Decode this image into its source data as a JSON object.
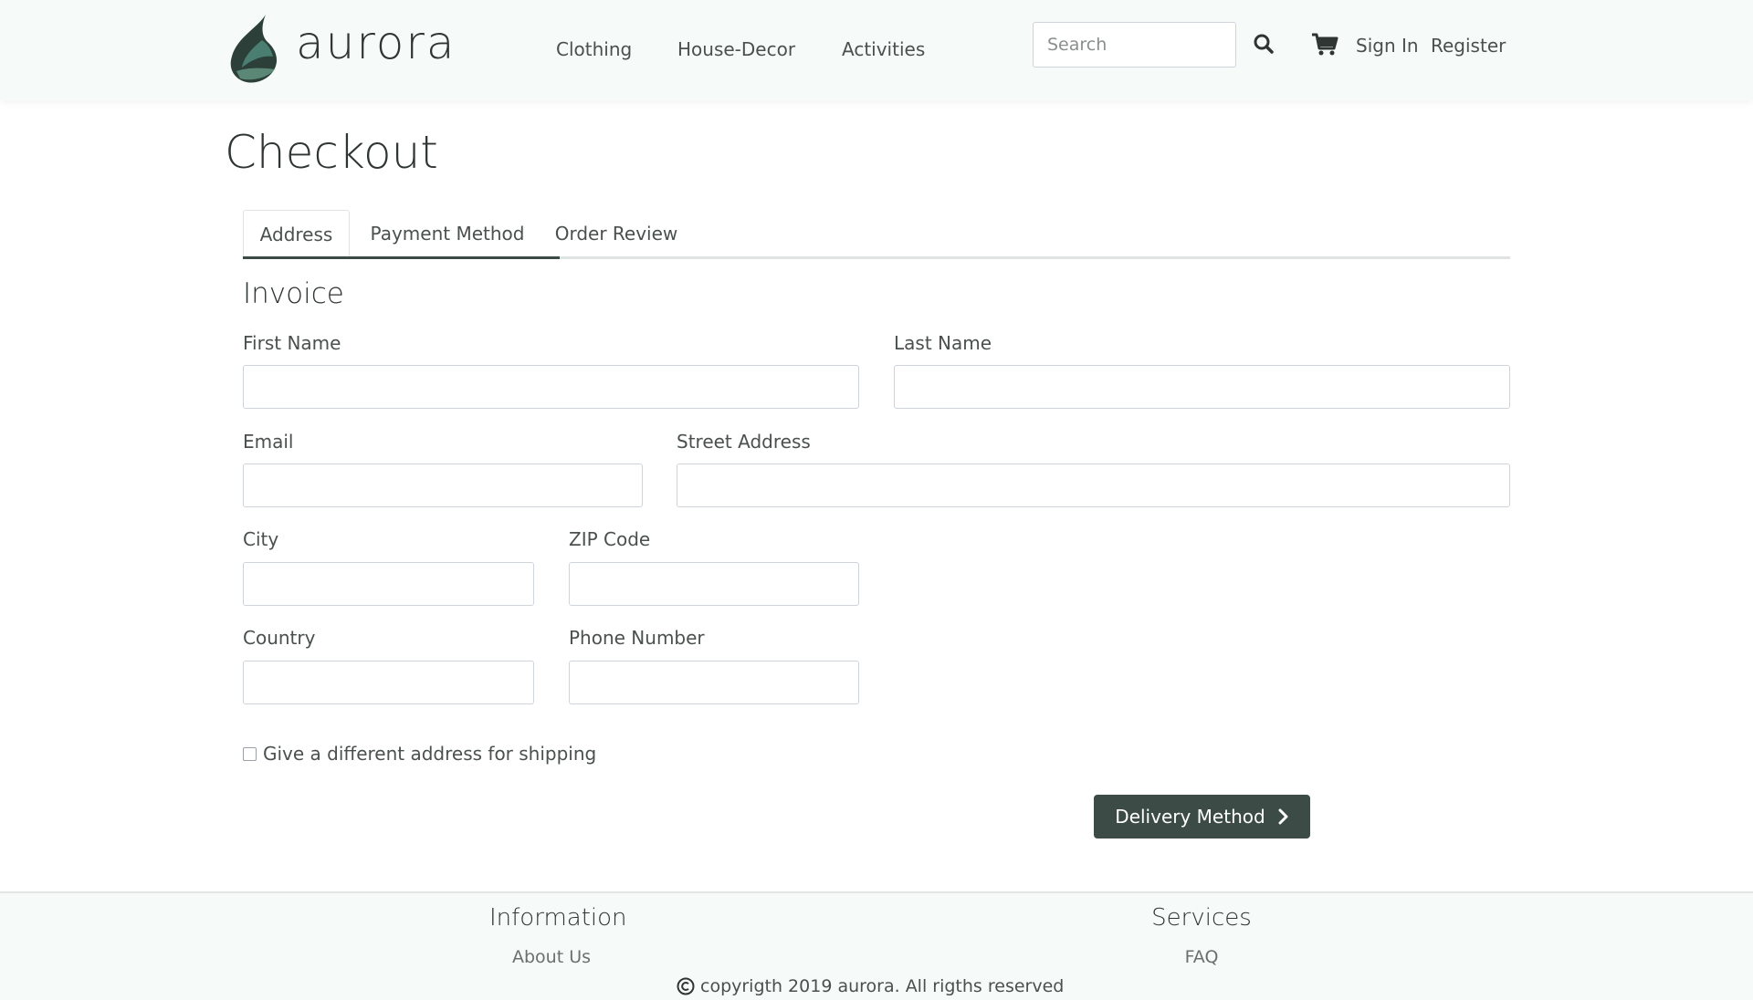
{
  "header": {
    "logo_text": "aurora",
    "nav": [
      "Clothing",
      "House-Decor",
      "Activities"
    ],
    "search_placeholder": "Search",
    "sign_in": "Sign In",
    "register": "Register",
    "icons": {
      "search": "search-icon",
      "cart": "cart-icon",
      "logo": "leaf-logo-icon"
    }
  },
  "main": {
    "title": "Checkout",
    "tabs": [
      {
        "label": "Address",
        "active": true
      },
      {
        "label": "Payment Method",
        "active": false
      },
      {
        "label": "Order Review",
        "active": false
      }
    ],
    "section_title": "Invoice",
    "fields": {
      "first_name": {
        "label": "First Name",
        "value": ""
      },
      "last_name": {
        "label": "Last Name",
        "value": ""
      },
      "email": {
        "label": "Email",
        "value": ""
      },
      "street": {
        "label": "Street Address",
        "value": ""
      },
      "city": {
        "label": "City",
        "value": ""
      },
      "zip": {
        "label": "ZIP Code",
        "value": ""
      },
      "country": {
        "label": "Country",
        "value": ""
      },
      "phone": {
        "label": "Phone Number",
        "value": ""
      }
    },
    "shipping_checkbox": {
      "label": "Give a different address for shipping",
      "checked": false
    },
    "next_button": {
      "label": "Delivery Method",
      "icon": "chevron-right-icon"
    }
  },
  "footer": {
    "information": {
      "heading": "Information",
      "links": [
        "About Us"
      ]
    },
    "services": {
      "heading": "Services",
      "links": [
        "FAQ"
      ]
    },
    "copyright": "copyrigth 2019 aurora. All rigths reserved",
    "copyright_icon": "copyright-icon"
  },
  "colors": {
    "header_bg": "#f6fbf9",
    "primary_button": "#3c4b46",
    "active_tab_underline": "#3a4a45",
    "text": "#4a504e"
  }
}
